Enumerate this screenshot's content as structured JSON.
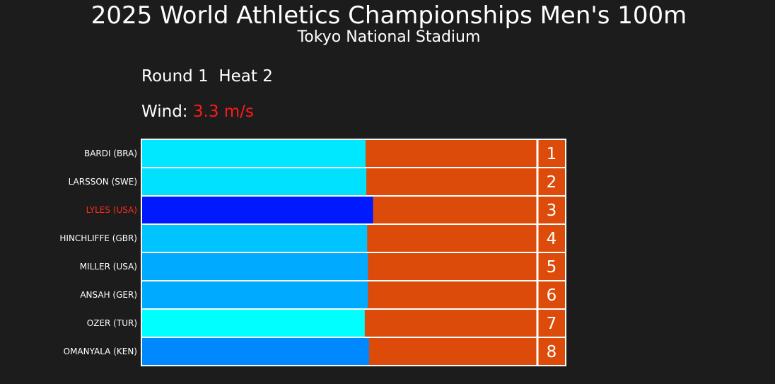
{
  "header": {
    "title": "2025 World Athletics Championships Men's 100m",
    "subtitle": "Tokyo National Stadium",
    "round": "Round 1  Heat 2",
    "wind_label": "Wind: ",
    "wind_value": "3.3 m/s"
  },
  "colors": {
    "background": "#1c1c1c",
    "remaining": "#dc4b0a",
    "highlight_text": "#ff2a1a",
    "wind_value": "#ff1a1a",
    "label_text": "#ffffff"
  },
  "chart_data": {
    "type": "bar",
    "orientation": "horizontal",
    "title": "2025 World Athletics Championships Men's 100m",
    "subtitle": "Tokyo National Stadium",
    "xlim": [
      0,
      1
    ],
    "categories": [
      "BARDI  (BRA)",
      "LARSSON  (SWE)",
      "LYLES  (USA)",
      "HINCHLIFFE  (GBR)",
      "MILLER  (USA)",
      "ANSAH  (GER)",
      "OZER  (TUR)",
      "OMANYALA  (KEN)"
    ],
    "places": [
      "1",
      "2",
      "3",
      "4",
      "5",
      "6",
      "7",
      "8"
    ],
    "progress": [
      0.566,
      0.568,
      0.585,
      0.57,
      0.572,
      0.572,
      0.564,
      0.575
    ],
    "bar_colors": [
      "#00e8ff",
      "#00e0ff",
      "#0019ff",
      "#00c4ff",
      "#00aaff",
      "#00aaff",
      "#00ffff",
      "#0088ff"
    ],
    "highlight": [
      false,
      false,
      true,
      false,
      false,
      false,
      false,
      false
    ],
    "grid": false,
    "legend": "none"
  }
}
